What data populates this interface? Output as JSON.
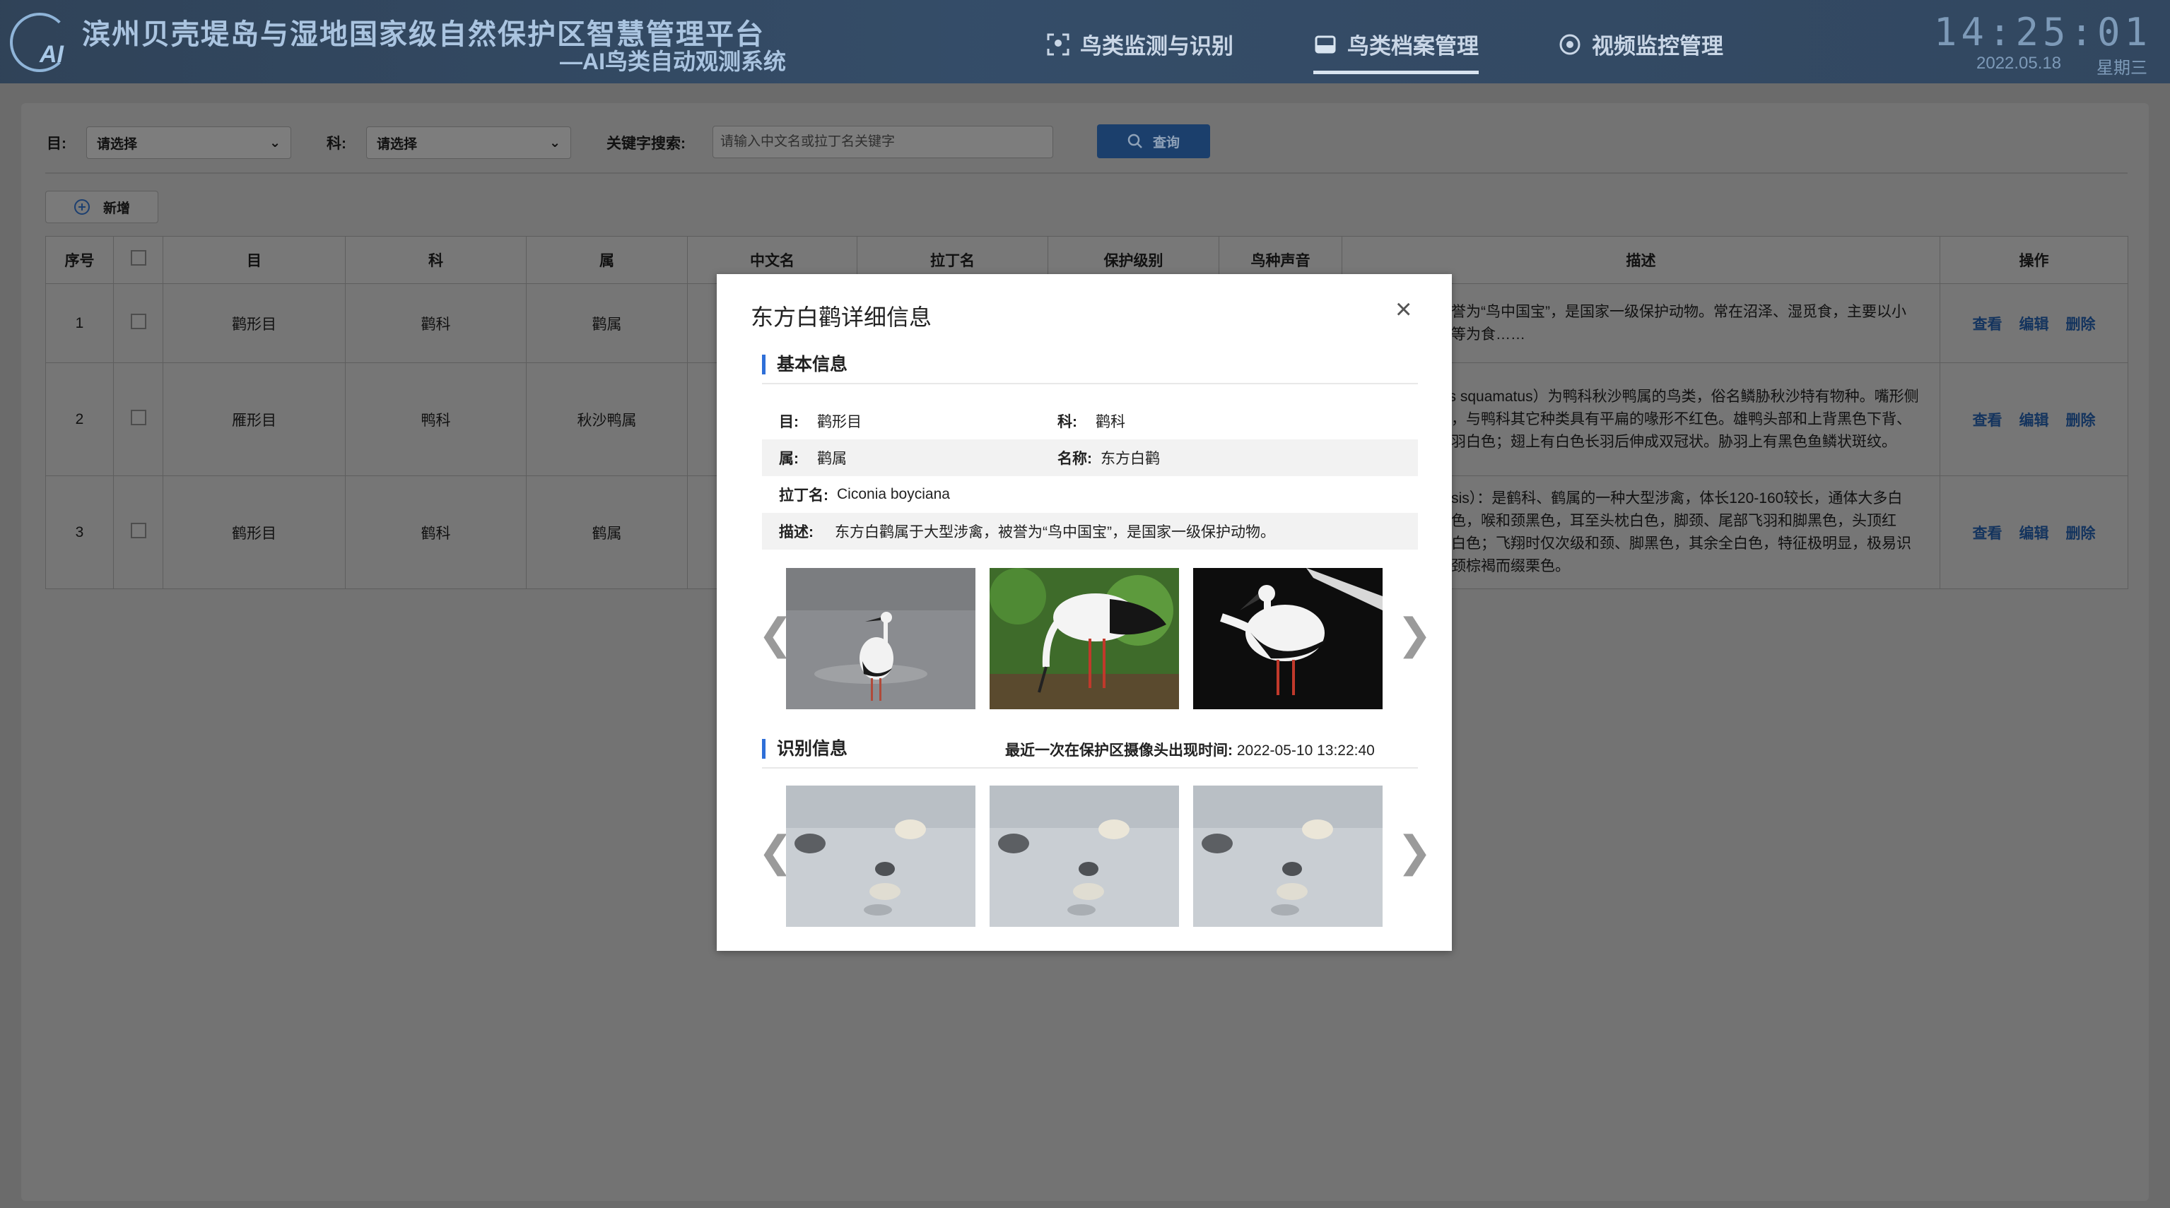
{
  "header": {
    "logo_text": "AI",
    "title_main": "滨州贝壳堤岛与湿地国家级自然保护区智慧管理平台",
    "title_sub": "—AI鸟类自动观测系统",
    "nav": [
      {
        "label": "鸟类监测与识别",
        "icon": "scan-icon"
      },
      {
        "label": "鸟类档案管理",
        "icon": "archive-icon",
        "active": true
      },
      {
        "label": "视频监控管理",
        "icon": "camera-icon"
      }
    ],
    "clock": "14:25:01",
    "date": "2022.05.18",
    "weekday": "星期三"
  },
  "filters": {
    "order_label": "目:",
    "order_value": "请选择",
    "family_label": "科:",
    "family_value": "请选择",
    "keyword_label": "关键字搜索:",
    "keyword_placeholder": "请输入中文名或拉丁名关键字",
    "query_label": "查询"
  },
  "add_label": "新增",
  "table": {
    "headers": [
      "序号",
      "",
      "目",
      "科",
      "属",
      "中文名",
      "拉丁名",
      "保护级别",
      "鸟种声音",
      "描述",
      "操作"
    ],
    "rows": [
      {
        "no": "1",
        "order": "鹳形目",
        "family": "鹳科",
        "genus": "鹳属",
        "desc": "大型涉禽，被誉为“鸟中国宝”，是国家一级保护动物。常在沼泽、湿觅食，主要以小鱼、蛙、昆虫等为食……"
      },
      {
        "no": "2",
        "order": "雁形目",
        "family": "鸭科",
        "genus": "秋沙鸭属",
        "desc": "学名：Mergus squamatus）为鸭科秋沙鸭属的鸟类，俗名鳞胁秋沙特有物种。嘴形侧扁，前端尖出，与鸭科其它种类具有平扁的喙形不红色。雄鸭头部和上背黑色下背、腰部和尾上覆羽白色；翅上有白色长羽后伸成双冠状。胁羽上有黑色鱼鳞状斑纹。"
      },
      {
        "no": "3",
        "order": "鹤形目",
        "family": "鹤科",
        "genus": "鹤属",
        "desc": "Grus japonensis）：是鹤科、鹤属的一种大型涉禽，体长120-160较长，通体大多白色，头顶鲜红色，喉和颈黑色，耳至头枕白色，脚颈、尾部飞羽和脚黑色，头顶红色，其余全为白色；飞翔时仅次级和颈、脚黑色，其余全白色，特征极明显，极易识别。幼鸟头、颈棕褐而缀栗色。"
      }
    ],
    "actions": [
      "查看",
      "编辑",
      "删除"
    ]
  },
  "modal": {
    "title": "东方白鹳详细信息",
    "basic_title": "基本信息",
    "order_label": "目:",
    "order_value": "鹳形目",
    "family_label": "科:",
    "family_value": "鹳科",
    "genus_label": "属:",
    "genus_value": "鹳属",
    "name_label": "名称:",
    "name_value": "东方白鹳",
    "latin_label": "拉丁名:",
    "latin_value": "Ciconia boyciana",
    "desc_label": "描述:",
    "desc_value": "东方白鹳属于大型涉禽，被誉为“鸟中国宝”，是国家一级保护动物。",
    "recog_title": "识别信息",
    "last_seen_label": "最近一次在保护区摄像头出现时间:",
    "last_seen_value": "2022-05-10 13:22:40",
    "prev_glyph": "❮",
    "next_glyph": "❯",
    "close_glyph": "×"
  }
}
